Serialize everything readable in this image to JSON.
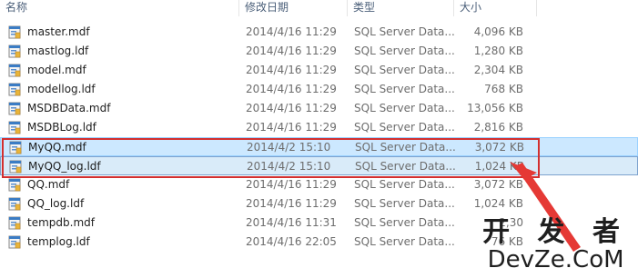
{
  "header": {
    "name": "名称",
    "date": "修改日期",
    "type": "类型",
    "size": "大小"
  },
  "files": [
    {
      "name": "master.mdf",
      "date": "2014/4/16 11:29",
      "type": "SQL Server Data...",
      "size": "4,096 KB"
    },
    {
      "name": "mastlog.ldf",
      "date": "2014/4/16 11:29",
      "type": "SQL Server Data...",
      "size": "1,280 KB"
    },
    {
      "name": "model.mdf",
      "date": "2014/4/16 11:29",
      "type": "SQL Server Data...",
      "size": "2,304 KB"
    },
    {
      "name": "modellog.ldf",
      "date": "2014/4/16 11:29",
      "type": "SQL Server Data...",
      "size": "768 KB"
    },
    {
      "name": "MSDBData.mdf",
      "date": "2014/4/16 11:29",
      "type": "SQL Server Data...",
      "size": "13,056 KB"
    },
    {
      "name": "MSDBLog.ldf",
      "date": "2014/4/16 11:29",
      "type": "SQL Server Data...",
      "size": "2,816 KB"
    },
    {
      "name": "MyQQ.mdf",
      "date": "2014/4/2 15:10",
      "type": "SQL Server Data...",
      "size": "3,072 KB"
    },
    {
      "name": "MyQQ_log.ldf",
      "date": "2014/4/2 15:10",
      "type": "SQL Server Data...",
      "size": "1,024 KB"
    },
    {
      "name": "QQ.mdf",
      "date": "2014/4/16 11:29",
      "type": "SQL Server Data...",
      "size": "3,072 KB"
    },
    {
      "name": "QQ_log.ldf",
      "date": "2014/4/16 11:29",
      "type": "SQL Server Data...",
      "size": "1,024 KB"
    },
    {
      "name": "tempdb.mdf",
      "date": "2014/4/16 11:31",
      "type": "SQL Server Data...",
      "size": "2,30"
    },
    {
      "name": "templog.ldf",
      "date": "2014/4/16 22:05",
      "type": "SQL Server Data...",
      "size": "76 KB"
    }
  ],
  "selected_rows": [
    "MyQQ.mdf",
    "MyQQ_log.ldf"
  ],
  "watermark": {
    "line1": "开 发 者",
    "line2": "DevZe.CoM"
  },
  "colors": {
    "selection": "#cce8ff",
    "highlight_box": "#d32f2f",
    "arrow": "#e53935"
  },
  "icons": {
    "file": "sql-data-file-icon"
  }
}
